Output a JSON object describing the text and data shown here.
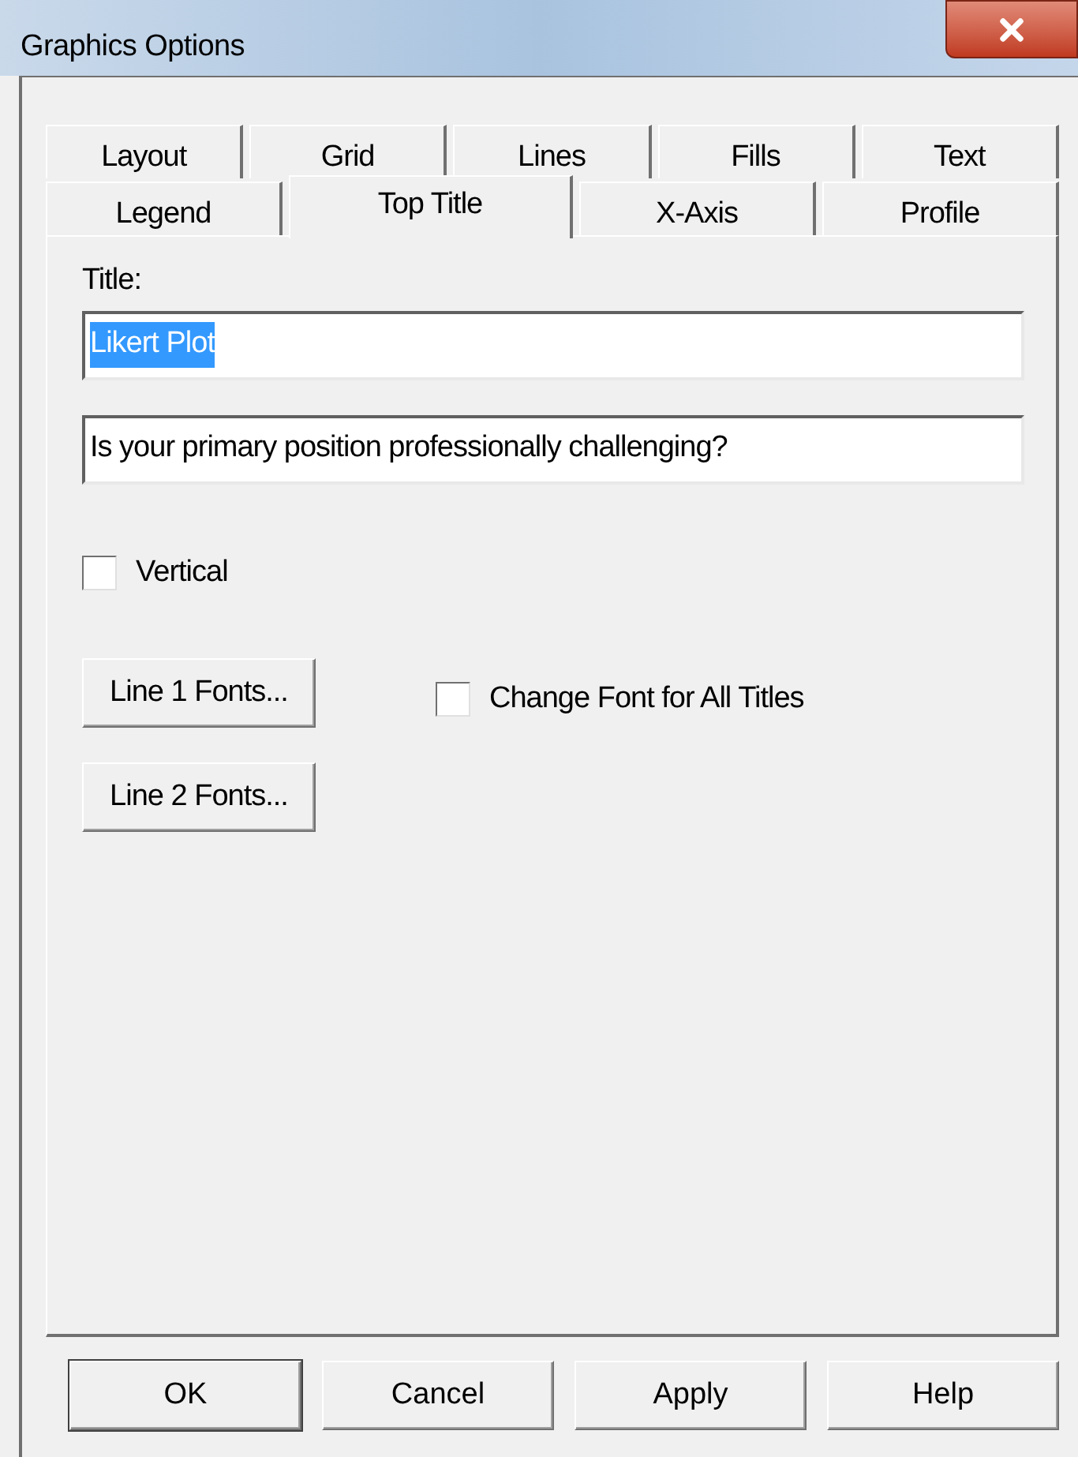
{
  "window": {
    "title": "Graphics Options"
  },
  "tab_rows": [
    [
      {
        "label": "Layout",
        "selected": false
      },
      {
        "label": "Grid",
        "selected": false
      },
      {
        "label": "Lines",
        "selected": false
      },
      {
        "label": "Fills",
        "selected": false
      },
      {
        "label": "Text",
        "selected": false
      }
    ],
    [
      {
        "label": "Legend",
        "selected": false
      },
      {
        "label": "Top Title",
        "selected": true
      },
      {
        "label": "X-Axis",
        "selected": false
      },
      {
        "label": "Profile",
        "selected": false
      }
    ]
  ],
  "title_label": "Title:",
  "title_fields": [
    {
      "value": "Likert Plot",
      "text_selected": true
    },
    {
      "value": "Is your primary position professionally challenging?",
      "text_selected": false
    }
  ],
  "vertical": {
    "label": "Vertical",
    "checked": false
  },
  "line1_button": "Line 1 Fonts...",
  "change_font": {
    "label": "Change Font for All Titles",
    "checked": false
  },
  "line2_button": "Line 2 Fonts...",
  "buttons": [
    {
      "label": "OK",
      "default": true
    },
    {
      "label": "Cancel",
      "default": false
    },
    {
      "label": "Apply",
      "default": false
    },
    {
      "label": "Help",
      "default": false
    }
  ]
}
